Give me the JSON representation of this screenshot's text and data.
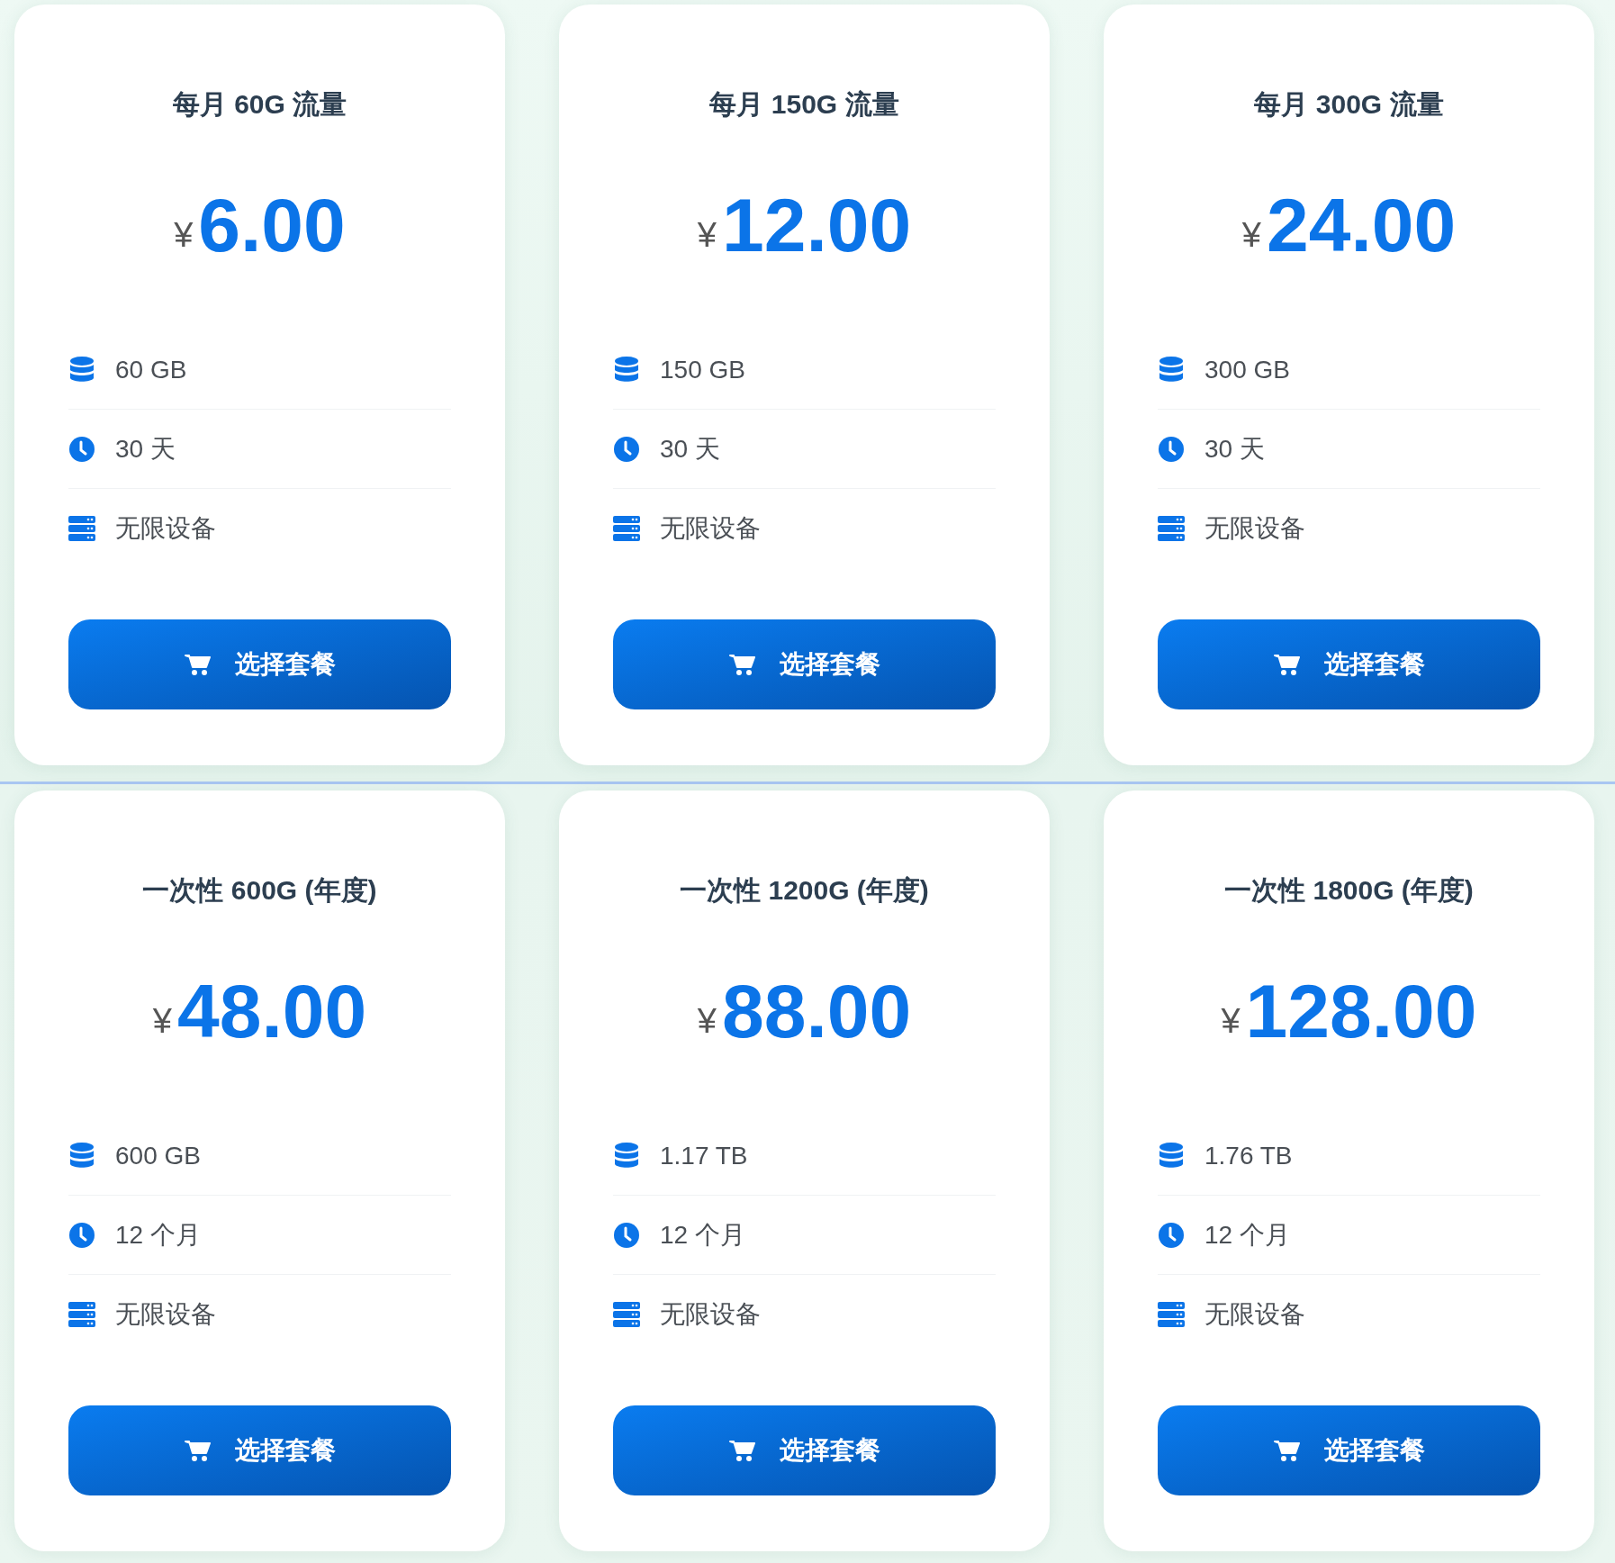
{
  "sections": [
    {
      "plans": [
        {
          "title": "每月 60G 流量",
          "currency": "¥",
          "price": "6.00",
          "features": [
            {
              "kind": "data",
              "text": "60 GB"
            },
            {
              "kind": "time",
              "text": "30 天"
            },
            {
              "kind": "devices",
              "text": "无限设备"
            }
          ],
          "button": "选择套餐"
        },
        {
          "title": "每月 150G 流量",
          "currency": "¥",
          "price": "12.00",
          "features": [
            {
              "kind": "data",
              "text": "150 GB"
            },
            {
              "kind": "time",
              "text": "30 天"
            },
            {
              "kind": "devices",
              "text": "无限设备"
            }
          ],
          "button": "选择套餐"
        },
        {
          "title": "每月 300G 流量",
          "currency": "¥",
          "price": "24.00",
          "features": [
            {
              "kind": "data",
              "text": "300 GB"
            },
            {
              "kind": "time",
              "text": "30 天"
            },
            {
              "kind": "devices",
              "text": "无限设备"
            }
          ],
          "button": "选择套餐"
        }
      ]
    },
    {
      "plans": [
        {
          "title": "一次性 600G (年度)",
          "currency": "¥",
          "price": "48.00",
          "features": [
            {
              "kind": "data",
              "text": "600 GB"
            },
            {
              "kind": "time",
              "text": "12 个月"
            },
            {
              "kind": "devices",
              "text": "无限设备"
            }
          ],
          "button": "选择套餐"
        },
        {
          "title": "一次性 1200G (年度)",
          "currency": "¥",
          "price": "88.00",
          "features": [
            {
              "kind": "data",
              "text": "1.17 TB"
            },
            {
              "kind": "time",
              "text": "12 个月"
            },
            {
              "kind": "devices",
              "text": "无限设备"
            }
          ],
          "button": "选择套餐"
        },
        {
          "title": "一次性 1800G (年度)",
          "currency": "¥",
          "price": "128.00",
          "features": [
            {
              "kind": "data",
              "text": "1.76 TB"
            },
            {
              "kind": "time",
              "text": "12 个月"
            },
            {
              "kind": "devices",
              "text": "无限设备"
            }
          ],
          "button": "选择套餐"
        }
      ]
    }
  ]
}
